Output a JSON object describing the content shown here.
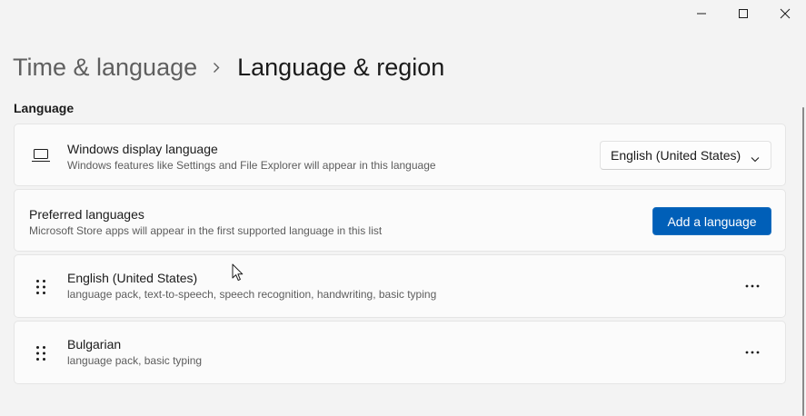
{
  "window": {
    "controls": [
      "minimize-icon",
      "maximize-icon",
      "close-icon"
    ]
  },
  "breadcrumb": {
    "parent": "Time & language",
    "separator_icon": "chevron-right-icon",
    "current": "Language & region"
  },
  "section": {
    "label": "Language"
  },
  "display_language": {
    "icon": "laptop-icon",
    "title": "Windows display language",
    "subtitle": "Windows features like Settings and File Explorer will appear in this language",
    "selected": "English (United States)"
  },
  "preferred": {
    "title": "Preferred languages",
    "subtitle": "Microsoft Store apps will appear in the first supported language in this list",
    "button_label": "Add a language"
  },
  "languages": [
    {
      "name": "English (United States)",
      "features": "language pack, text-to-speech, speech recognition, handwriting, basic typing"
    },
    {
      "name": "Bulgarian",
      "features": "language pack, basic typing"
    }
  ],
  "colors": {
    "accent": "#005fb8",
    "background": "#f3f3f3",
    "card": "#fbfbfb"
  }
}
